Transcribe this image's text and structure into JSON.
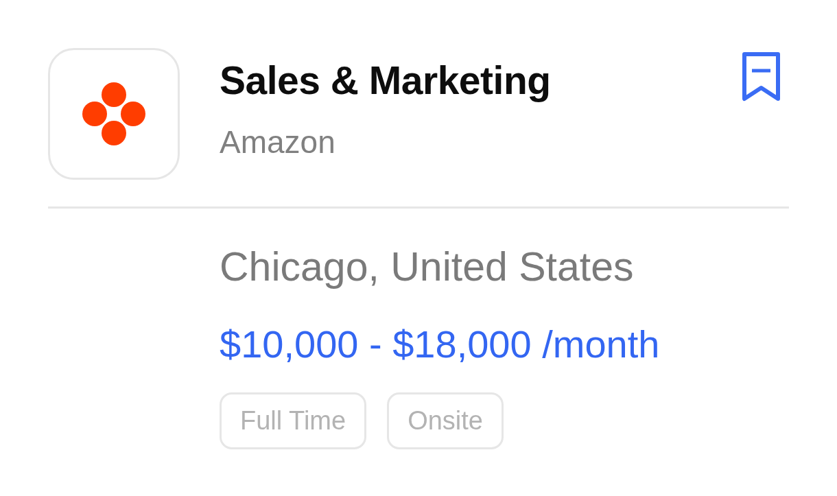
{
  "job": {
    "title": "Sales & Marketing",
    "company": "Amazon",
    "location": "Chicago, United States",
    "salary": "$10,000 - $18,000 /month",
    "tags": [
      "Full Time",
      "Onsite"
    ]
  }
}
